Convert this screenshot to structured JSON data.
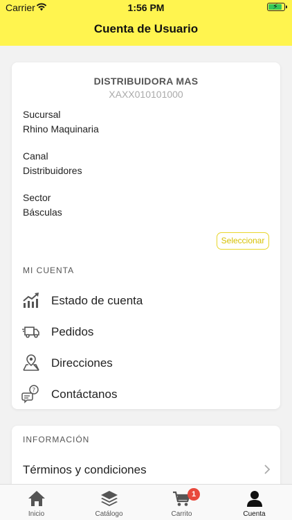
{
  "status_bar": {
    "carrier": "Carrier",
    "time": "1:56 PM"
  },
  "header": {
    "title": "Cuenta de Usuario"
  },
  "account": {
    "name": "DISTRIBUIDORA MAS",
    "rfc": "XAXX010101000",
    "fields": [
      {
        "label": "Sucursal",
        "value": "Rhino Maquinaria"
      },
      {
        "label": "Canal",
        "value": "Distribuidores"
      },
      {
        "label": "Sector",
        "value": "Básculas"
      }
    ],
    "select_label": "Seleccionar"
  },
  "mi_cuenta": {
    "title": "MI CUENTA",
    "items": [
      {
        "label": "Estado de cuenta",
        "icon": "chart-growth-icon"
      },
      {
        "label": "Pedidos",
        "icon": "delivery-truck-icon"
      },
      {
        "label": "Direcciones",
        "icon": "map-pin-icon"
      },
      {
        "label": "Contáctanos",
        "icon": "chat-question-icon"
      }
    ]
  },
  "informacion": {
    "title": "INFORMACIÓN",
    "items": [
      {
        "label": "Términos y condiciones"
      }
    ]
  },
  "tabbar": {
    "tabs": [
      {
        "label": "Inicio",
        "icon": "home-icon"
      },
      {
        "label": "Catálogo",
        "icon": "layers-icon"
      },
      {
        "label": "Carrito",
        "icon": "cart-icon",
        "badge": "1"
      },
      {
        "label": "Cuenta",
        "icon": "user-icon",
        "active": true
      }
    ]
  },
  "colors": {
    "accent": "#fff44f",
    "badge": "#e8483c",
    "select_border": "#e8d52a"
  }
}
